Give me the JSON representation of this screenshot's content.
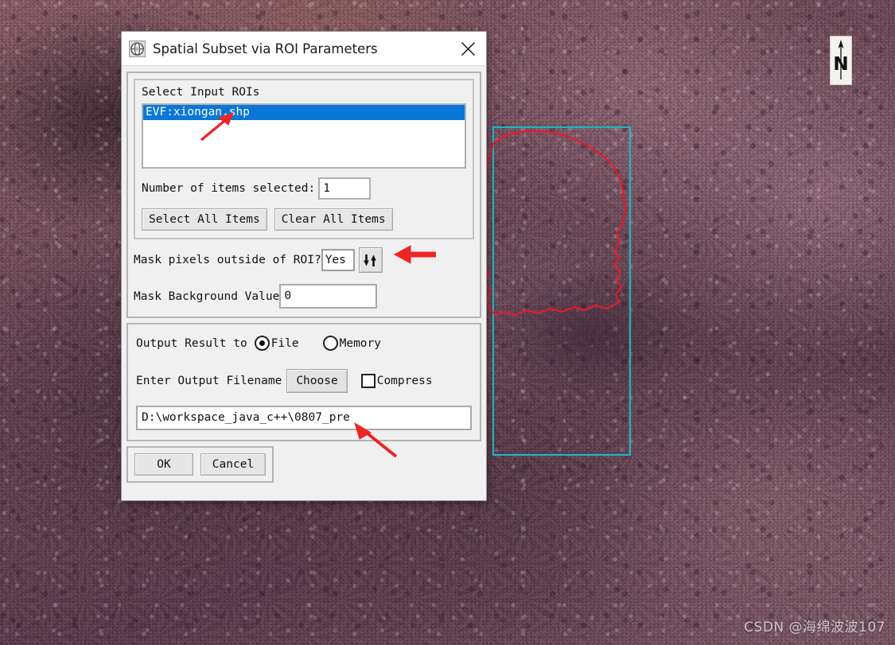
{
  "background": {
    "type": "satellite-imagery",
    "description": "Remote sensing false-color satellite image of Xiongan area",
    "roi_outline_color": "#e8192c",
    "extent_box_color": "#1fb5c4",
    "compass_label": "N",
    "compass_icon": "north-arrow-icon"
  },
  "watermark": {
    "text": "CSDN @海绵波波107"
  },
  "dialog": {
    "title": "Spatial Subset via ROI Parameters",
    "app_icon": "envi-globe-icon",
    "close_icon": "close-icon",
    "roi_group": {
      "label": "Select Input ROIs",
      "items": [
        {
          "label": "EVF:xiongan.shp",
          "selected": true
        }
      ],
      "count_label": "Number of items selected:",
      "count_value": "1",
      "select_all_label": "Select All Items",
      "clear_all_label": "Clear All Items"
    },
    "mask": {
      "question_label": "Mask pixels outside of ROI?",
      "toggle_value": "Yes",
      "toggle_icon": "updown-arrows-icon",
      "background_label": "Mask Background Value",
      "background_value": "0"
    },
    "output": {
      "result_label": "Output Result to",
      "options": [
        {
          "label": "File",
          "selected": true
        },
        {
          "label": "Memory",
          "selected": false
        }
      ],
      "filename_label": "Enter Output Filename",
      "choose_label": "Choose",
      "compress_label": "Compress",
      "compress_checked": false,
      "filename_value": "D:\\workspace_java_c++\\0807_pre"
    },
    "footer": {
      "ok_label": "OK",
      "cancel_label": "Cancel"
    }
  },
  "annotations": [
    {
      "name": "arrow-to-roi-item",
      "color": "#ef2424"
    },
    {
      "name": "arrow-to-mask-toggle",
      "color": "#ef2424"
    },
    {
      "name": "arrow-to-output-path",
      "color": "#ef2424"
    }
  ]
}
